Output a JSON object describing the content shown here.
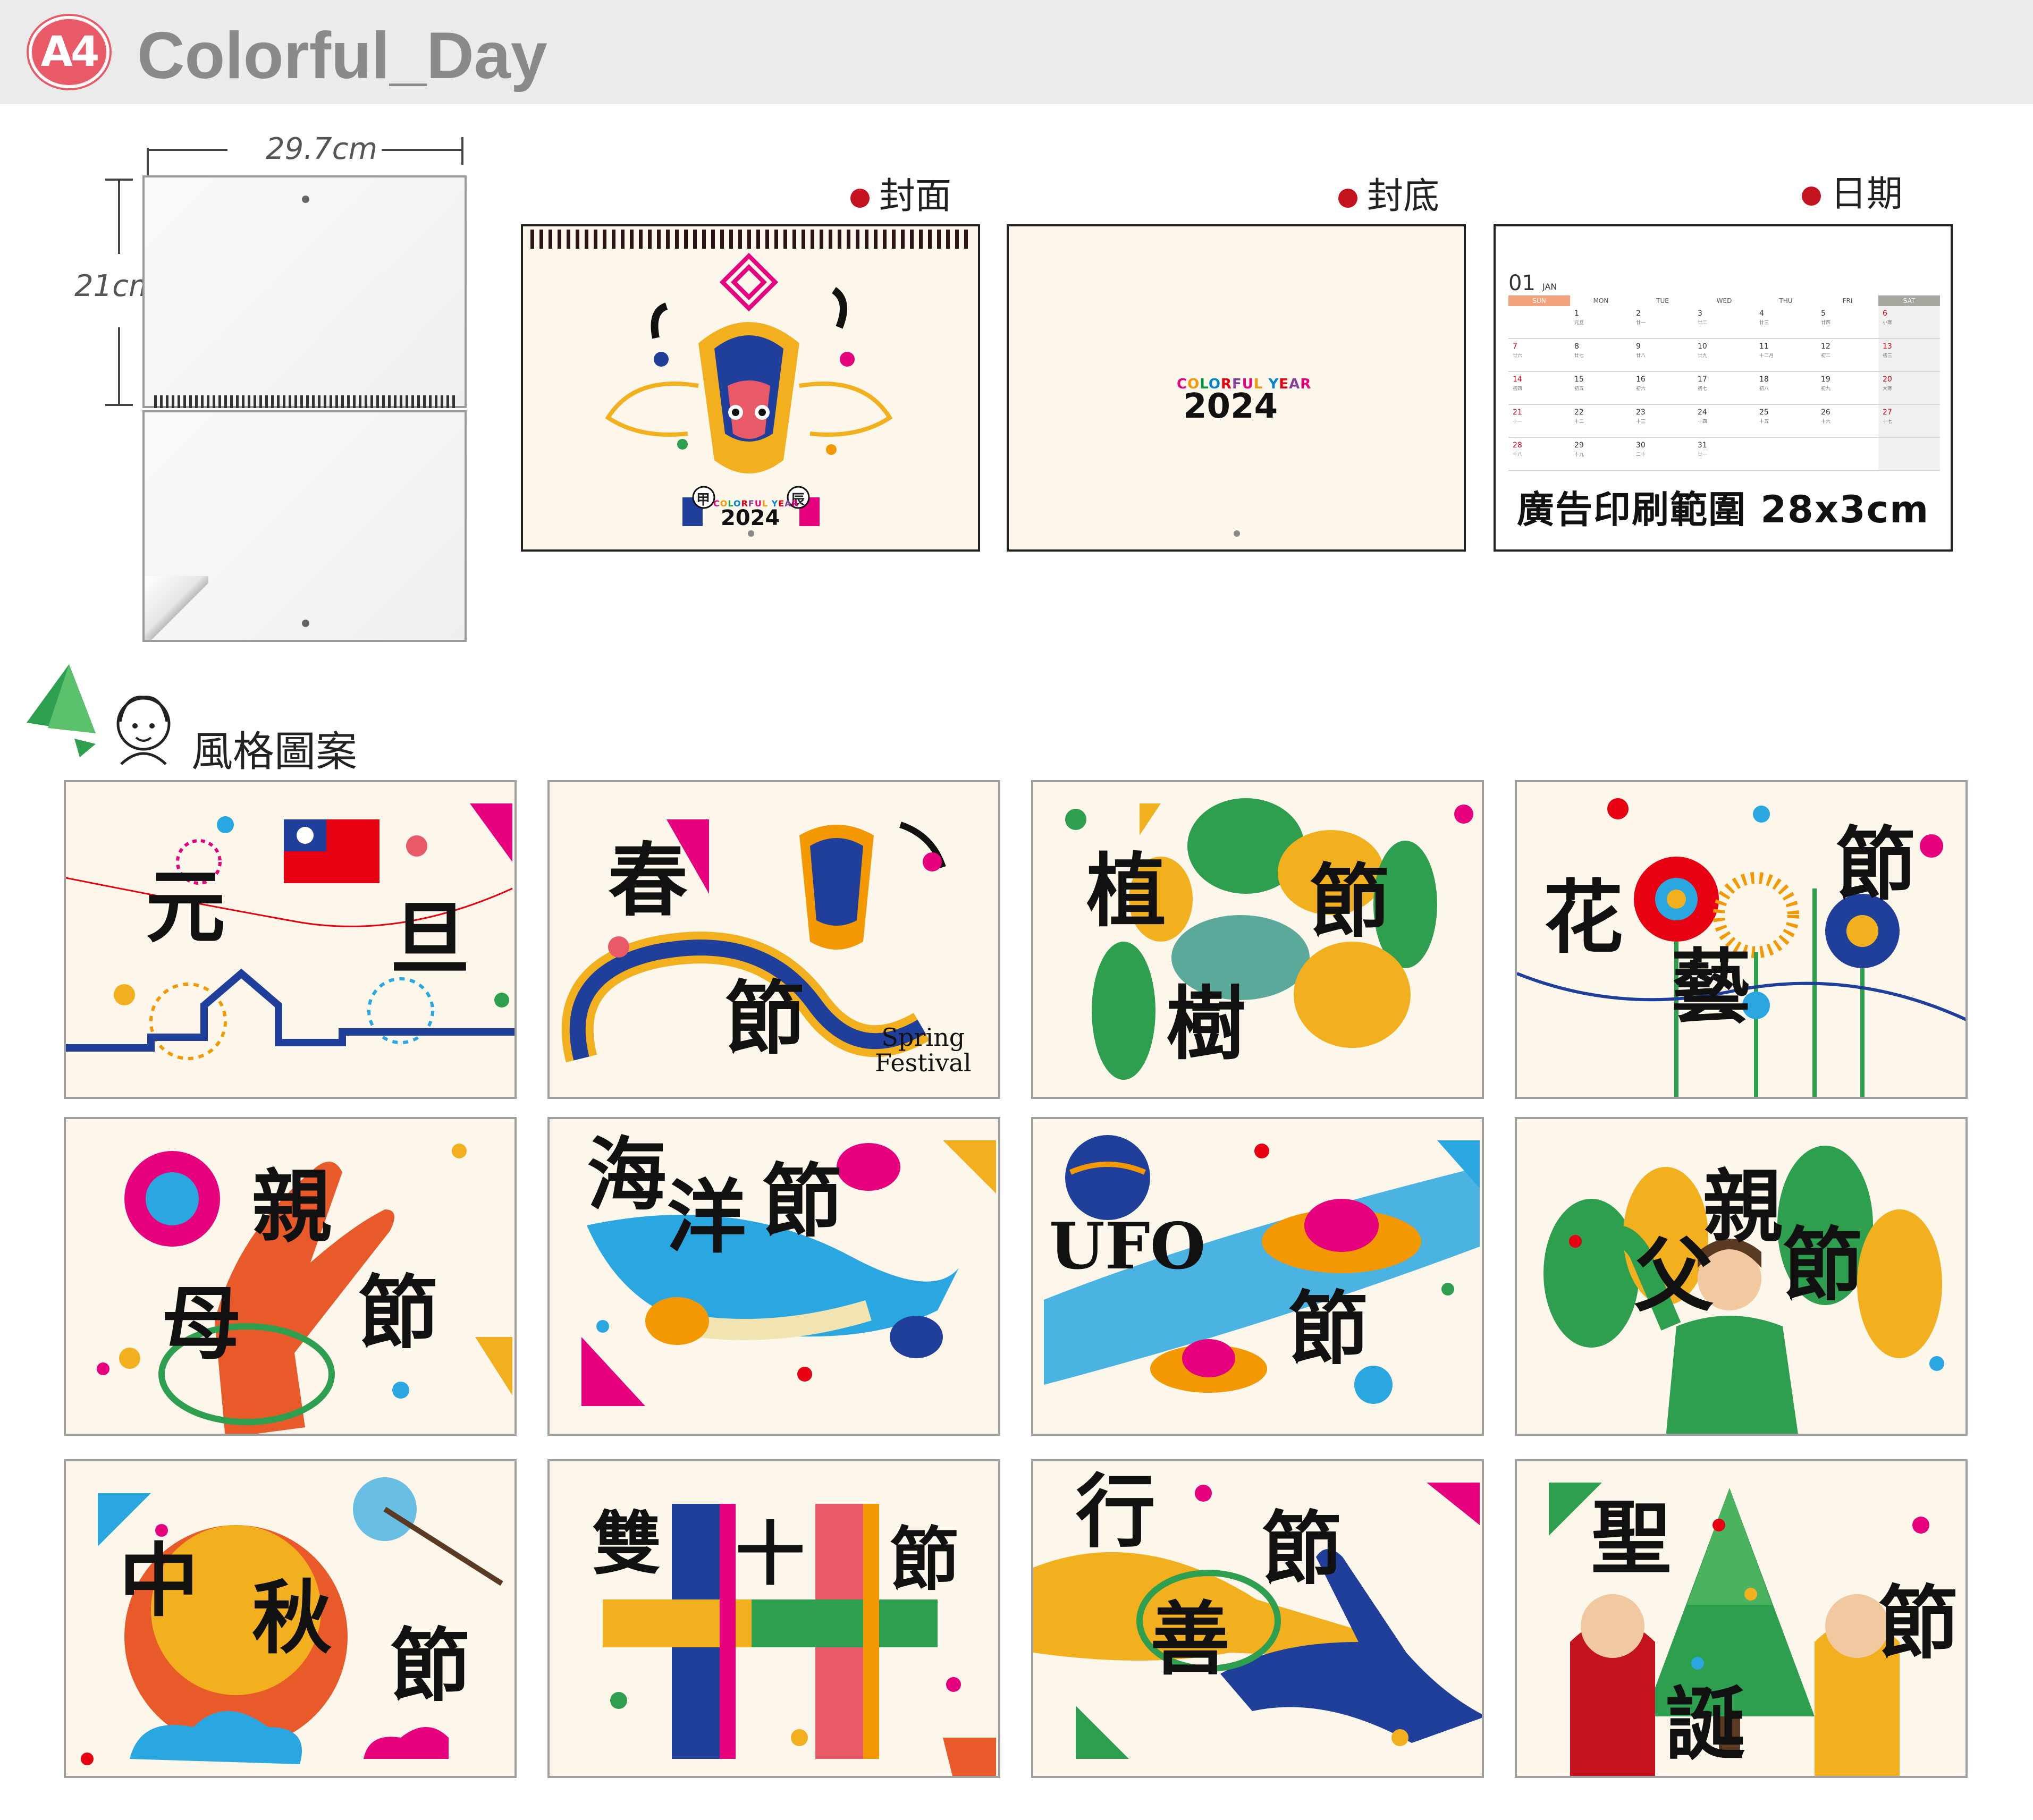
{
  "header": {
    "badge": "A4",
    "title": "Colorful_Day"
  },
  "dimensions": {
    "width": "29.7cm",
    "height": "21cm"
  },
  "panels": {
    "cover_label": "封面",
    "back_label": "封底",
    "date_label": "日期"
  },
  "cover": {
    "stem_left": "甲",
    "stem_right": "辰",
    "brand": "COLORFUL YEAR",
    "year": "2024"
  },
  "back": {
    "brand": "COLORFUL YEAR",
    "year": "2024"
  },
  "calendar": {
    "month_num": "01",
    "month_name": "JAN",
    "weekdays": [
      "SUN",
      "MON",
      "TUE",
      "WED",
      "THU",
      "FRI",
      "SAT"
    ],
    "rows": [
      [
        [
          "",
          ""
        ],
        [
          "1",
          "元旦"
        ],
        [
          "2",
          "廿一"
        ],
        [
          "3",
          "廿二"
        ],
        [
          "4",
          "廿三"
        ],
        [
          "5",
          "廿四"
        ],
        [
          "6",
          "小寒"
        ]
      ],
      [
        [
          "7",
          "廿六"
        ],
        [
          "8",
          "廿七"
        ],
        [
          "9",
          "廿八"
        ],
        [
          "10",
          "廿九"
        ],
        [
          "11",
          "十二月"
        ],
        [
          "12",
          "初二"
        ],
        [
          "13",
          "初三"
        ]
      ],
      [
        [
          "14",
          "初四"
        ],
        [
          "15",
          "初五"
        ],
        [
          "16",
          "初六"
        ],
        [
          "17",
          "初七"
        ],
        [
          "18",
          "初八"
        ],
        [
          "19",
          "初九"
        ],
        [
          "20",
          "大寒"
        ]
      ],
      [
        [
          "21",
          "十一"
        ],
        [
          "22",
          "十二"
        ],
        [
          "23",
          "十三"
        ],
        [
          "24",
          "十四"
        ],
        [
          "25",
          "十五"
        ],
        [
          "26",
          "十六"
        ],
        [
          "27",
          "十七"
        ]
      ],
      [
        [
          "28",
          "十八"
        ],
        [
          "29",
          "十九"
        ],
        [
          "30",
          "二十"
        ],
        [
          "31",
          "廿一"
        ],
        [
          "",
          ""
        ],
        [
          "",
          ""
        ],
        [
          "",
          ""
        ]
      ]
    ],
    "ad_area": "廣告印刷範圍 28x3cm"
  },
  "styles_heading": "風格圖案",
  "thumbnails": [
    {
      "chars": [
        "元",
        "旦"
      ]
    },
    {
      "chars": [
        "春",
        "節"
      ],
      "caption": "Spring\nFestival"
    },
    {
      "chars": [
        "植",
        "樹",
        "節"
      ]
    },
    {
      "chars": [
        "花",
        "藝",
        "節"
      ]
    },
    {
      "chars": [
        "母",
        "親",
        "節"
      ]
    },
    {
      "chars": [
        "海",
        "洋",
        "節"
      ]
    },
    {
      "chars": [
        "UFO",
        "節"
      ]
    },
    {
      "chars": [
        "父",
        "親",
        "節"
      ]
    },
    {
      "chars": [
        "中",
        "秋",
        "節"
      ]
    },
    {
      "chars": [
        "雙",
        "十",
        "節"
      ]
    },
    {
      "chars": [
        "行",
        "善",
        "節"
      ]
    },
    {
      "chars": [
        "聖",
        "誕",
        "節"
      ]
    }
  ],
  "colors": {
    "badge": "#e95a69",
    "accent_red": "#c4121f",
    "paper": "#fdf6ea",
    "magenta": "#e6007e",
    "orange": "#f39800",
    "green": "#2e9e4f",
    "blue": "#1f3f9a",
    "yellow": "#f2b01e",
    "cyan": "#2aa7e0"
  }
}
